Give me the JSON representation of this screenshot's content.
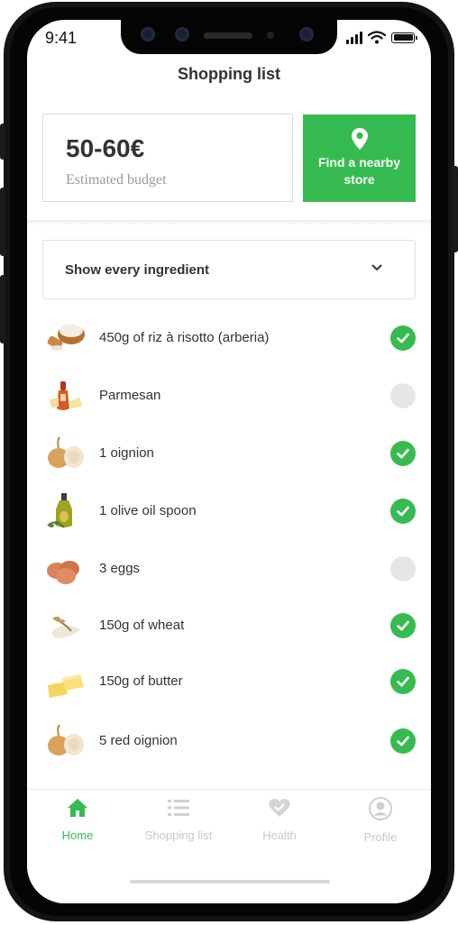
{
  "status_bar": {
    "time": "9:41"
  },
  "header": {
    "title": "Shopping list"
  },
  "budget": {
    "value": "50-60€",
    "label": "Estimated budget"
  },
  "store_button": {
    "label": "Find a nearby store",
    "icon": "location-pin-icon"
  },
  "filter": {
    "label": "Show every ingredient",
    "icon": "chevron-down-icon"
  },
  "ingredients": [
    {
      "name": "450g of riz à risotto (arberia)",
      "checked": true,
      "icon": "rice-bowl-icon"
    },
    {
      "name": "Parmesan",
      "checked": false,
      "icon": "cheese-icon"
    },
    {
      "name": "1 oignion",
      "checked": true,
      "icon": "onion-icon"
    },
    {
      "name": "1 olive oil spoon",
      "checked": true,
      "icon": "olive-oil-icon"
    },
    {
      "name": "3 eggs",
      "checked": false,
      "icon": "eggs-icon"
    },
    {
      "name": "150g of wheat",
      "checked": true,
      "icon": "wheat-flour-icon"
    },
    {
      "name": "150g of butter",
      "checked": true,
      "icon": "butter-icon"
    },
    {
      "name": "5 red oignion",
      "checked": true,
      "icon": "red-onion-icon"
    }
  ],
  "tabs": [
    {
      "label": "Home",
      "icon": "home-icon",
      "active": true
    },
    {
      "label": "Shopping list",
      "icon": "list-icon",
      "active": false
    },
    {
      "label": "Health",
      "icon": "heart-check-icon",
      "active": false
    },
    {
      "label": "Profile",
      "icon": "profile-icon",
      "active": false
    }
  ],
  "colors": {
    "accent": "#36bb50",
    "inactive": "#c8c8c8",
    "unchecked": "#e6e6e6",
    "text": "#333333"
  }
}
